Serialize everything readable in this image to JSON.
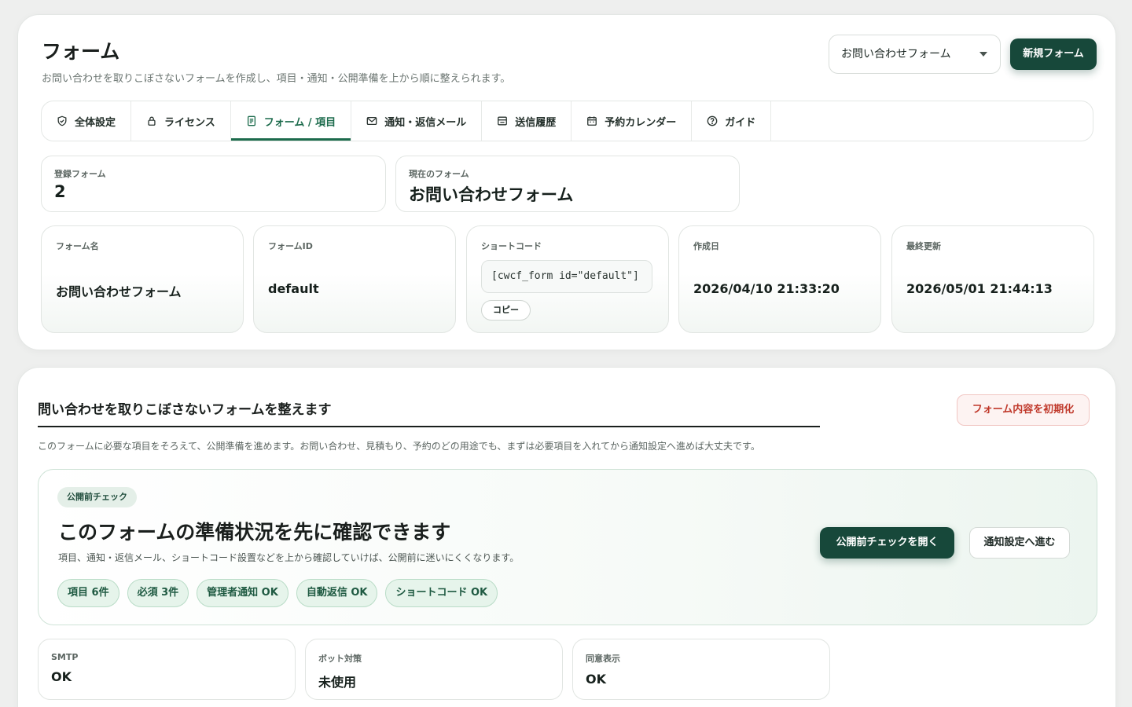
{
  "header": {
    "title": "フォーム",
    "subtitle": "お問い合わせを取りこぼさないフォームを作成し、項目・通知・公開準備を上から順に整えられます。",
    "form_select_value": "お問い合わせフォーム",
    "new_form_label": "新規フォーム"
  },
  "tabs": [
    {
      "label": "全体設定",
      "icon": "shield-check-icon"
    },
    {
      "label": "ライセンス",
      "icon": "lock-icon"
    },
    {
      "label": "フォーム / 項目",
      "icon": "document-icon"
    },
    {
      "label": "通知・返信メール",
      "icon": "mail-icon"
    },
    {
      "label": "送信履歴",
      "icon": "inbox-icon"
    },
    {
      "label": "予約カレンダー",
      "icon": "calendar-icon"
    },
    {
      "label": "ガイド",
      "icon": "help-circle-icon"
    }
  ],
  "active_tab": "フォーム / 項目",
  "stats": {
    "registered_label": "登録フォーム",
    "registered_value": "2",
    "current_label": "現在のフォーム",
    "current_value": "お問い合わせフォーム"
  },
  "meta": {
    "name_label": "フォーム名",
    "name_value": "お問い合わせフォーム",
    "id_label": "フォームID",
    "id_value": "default",
    "shortcode_label": "ショートコード",
    "shortcode_value": "[cwcf_form id=\"default\"]",
    "copy_label": "コピー",
    "created_label": "作成日",
    "created_value": "2026/04/10 21:33:20",
    "updated_label": "最終更新",
    "updated_value": "2026/05/01 21:44:13"
  },
  "section": {
    "title": "問い合わせを取りこぼさないフォームを整えます",
    "reset_label": "フォーム内容を初期化",
    "description": "このフォームに必要な項目をそろえて、公開準備を進めます。お問い合わせ、見積もり、予約のどの用途でも、まずは必要項目を入れてから通知設定へ進めば大丈夫です。"
  },
  "check": {
    "badge": "公開前チェック",
    "title": "このフォームの準備状況を先に確認できます",
    "description": "項目、通知・返信メール、ショートコード設置などを上から確認していけば、公開前に迷いにくくなります。",
    "pills": [
      "項目 6件",
      "必須 3件",
      "管理者通知 OK",
      "自動返信 OK",
      "ショートコード OK"
    ],
    "open_label": "公開前チェックを開く",
    "next_label": "通知設定へ進む"
  },
  "status": [
    {
      "label": "SMTP",
      "value": "OK"
    },
    {
      "label": "ボット対策",
      "value": "未使用"
    },
    {
      "label": "同意表示",
      "value": "OK"
    }
  ],
  "colors": {
    "accent": "#17483a",
    "active_tab": "#1c6b4c",
    "danger": "#c0392b",
    "pill_bg": "#e6f4eb"
  }
}
